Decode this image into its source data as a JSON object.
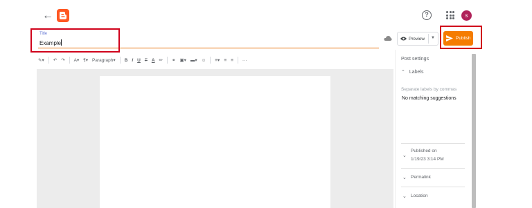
{
  "header": {
    "back_icon": "arrow-left-icon",
    "logo": "blogger-logo",
    "help_icon": "help-circle-icon",
    "apps_icon": "apps-grid-icon",
    "avatar_initial": "s",
    "avatar_color": "#b0235a"
  },
  "title_field": {
    "label": "Title",
    "value": "Example"
  },
  "actions": {
    "cloud_icon": "cloud-saved-icon",
    "preview_label": "Preview",
    "publish_label": "Publish",
    "publish_color": "#f57c00"
  },
  "toolbar": {
    "paragraph_label": "Paragraph",
    "more_label": "···"
  },
  "post_settings": {
    "title": "Post settings",
    "labels_header": "Labels",
    "labels_placeholder": "Separate labels by commas",
    "no_matching": "No matching suggestions",
    "published_on_label": "Published on",
    "published_on_value": "1/19/23 3:14 PM",
    "permalink_label": "Permalink",
    "location_label": "Location"
  },
  "annotation_color": "#d0021b"
}
